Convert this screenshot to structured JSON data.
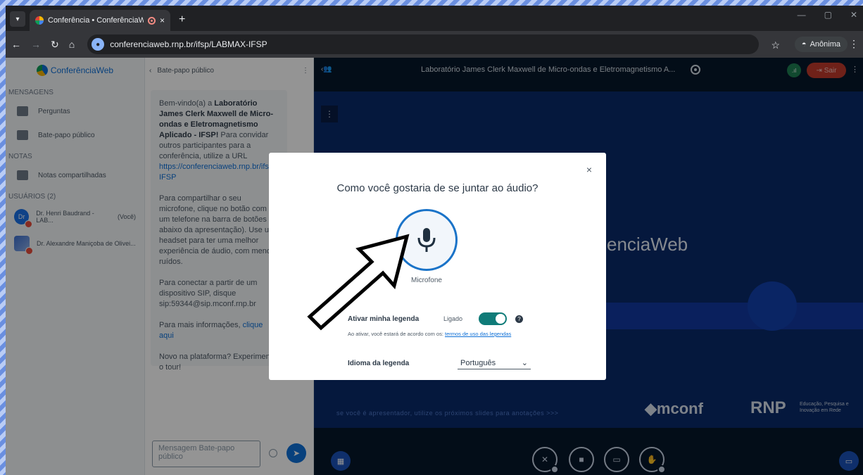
{
  "browser": {
    "tab_title": "Conferência • ConferênciaW",
    "tab_close": "×",
    "new_tab": "+",
    "url": "conferenciaweb.rnp.br/ifsp/LABMAX-IFSP",
    "profile_label": "Anônima"
  },
  "sidebar": {
    "brand": "ConferênciaWeb",
    "messages_header": "MENSAGENS",
    "items": [
      {
        "label": "Perguntas"
      },
      {
        "label": "Bate-papo público"
      }
    ],
    "notes_header": "NOTAS",
    "notes_item": "Notas compartilhadas",
    "users_header": "USUÁRIOS  (2)",
    "users": [
      {
        "initials": "Dr",
        "name": "Dr. Henri Baudrand - LAB...",
        "tag": "(Você)"
      },
      {
        "initials": "",
        "name": "Dr. Alexandre Maniçoba de Olivei...",
        "tag": ""
      }
    ]
  },
  "chat": {
    "header": "Bate-papo público",
    "welcome_prefix": "Bem-vindo(a) a ",
    "welcome_room": "Laboratório James Clerk Maxwell de Micro-ondas e Eletromagnetismo Aplicado - IFSP",
    "welcome_suffix": "!",
    "invite_text": "Para convidar outros participantes para a conferência, utilize a URL",
    "invite_url": "https://conferenciaweb.rnp.br/ifsp/LABMAX-IFSP",
    "mic_text": "Para compartilhar o seu microfone, clique no botão com um telefone na barra de botões abaixo da apresentação). Use um headset para ter uma melhor experiência de áudio, com menos ruídos.",
    "sip_text": "Para conectar a partir de um dispositivo SIP, disque sip:59344@sip.mconf.rnp.br",
    "info_prefix": "Para mais informações, ",
    "info_link": "clique aqui",
    "tour_text": "Novo na plataforma? Experimente o tour!",
    "composer_placeholder": "Mensagem Bate-papo público"
  },
  "stage": {
    "title": "Laboratório James Clerk Maxwell de Micro-ondas e Eletromagnetismo A...",
    "leave_label": "Sair",
    "slide_logo": "enciaWeb",
    "slide_hint": "se você é apresentador, utilize os próximos slides para anotações >>>",
    "mconf": "mconf",
    "rnp": "RNP",
    "rnp_sub": "Educação, Pesquisa e Inovação em Rede"
  },
  "modal": {
    "close": "×",
    "title": "Como você gostaria de se juntar ao áudio?",
    "mic_label": "Microfone",
    "caption_label": "Ativar minha legenda",
    "caption_state": "Ligado",
    "help": "?",
    "terms_prefix": "Ao ativar, você estará de acordo com os: ",
    "terms_link": "termos de uso das legendas",
    "language_label": "Idioma da legenda",
    "language_value": "Português"
  },
  "colors": {
    "accent": "#0f70d7",
    "toggle_on": "#0f7b78",
    "leave": "#c0392b"
  }
}
